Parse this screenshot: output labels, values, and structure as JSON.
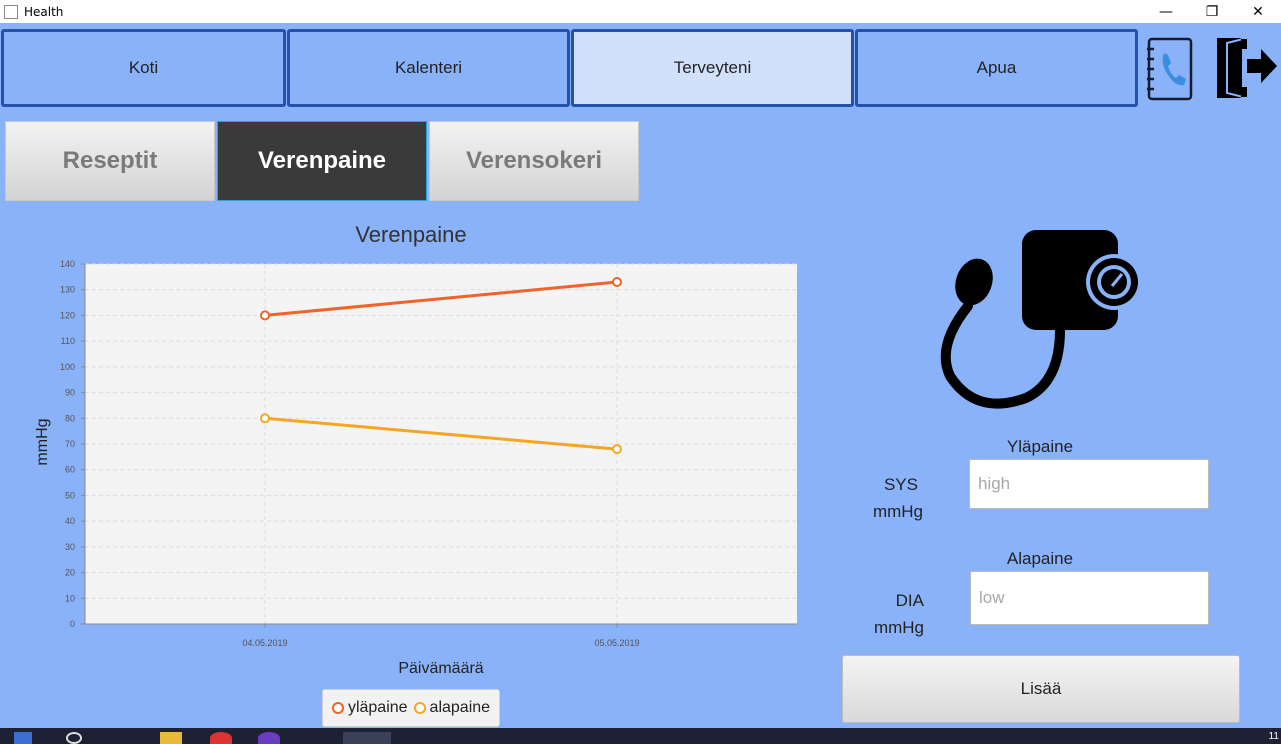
{
  "window": {
    "title": "Health"
  },
  "nav": {
    "tabs": [
      {
        "label": "Koti"
      },
      {
        "label": "Kalenteri"
      },
      {
        "label": "Terveyteni"
      },
      {
        "label": "Apua"
      }
    ],
    "active_index": 2
  },
  "subtabs": {
    "items": [
      {
        "label": "Reseptit"
      },
      {
        "label": "Verenpaine"
      },
      {
        "label": "Verensokeri"
      }
    ],
    "active_index": 1
  },
  "chart_data": {
    "type": "line",
    "title": "Verenpaine",
    "xlabel": "Päivämäärä",
    "ylabel": "mmHg",
    "categories": [
      "04.05.2019",
      "05.05.2019"
    ],
    "series": [
      {
        "name": "yläpaine",
        "values": [
          120,
          133
        ],
        "color": "#f0632a"
      },
      {
        "name": "alapaine",
        "values": [
          80,
          68
        ],
        "color": "#f5a623"
      }
    ],
    "ylim": [
      0,
      140
    ],
    "yticks": [
      0,
      10,
      20,
      30,
      40,
      50,
      60,
      70,
      80,
      90,
      100,
      110,
      120,
      130,
      140
    ],
    "grid": true,
    "legend": "bottom"
  },
  "form": {
    "high_title": "Yläpaine",
    "high_unit_line1": "SYS",
    "high_unit_line2": "mmHg",
    "high_placeholder": "high",
    "low_title": "Alapaine",
    "low_unit_line1": "DIA",
    "low_unit_line2": "mmHg",
    "low_placeholder": "low",
    "submit_label": "Lisää"
  },
  "taskbar": {
    "clock": "11"
  },
  "colors": {
    "background": "#8ab2f8",
    "nav_border": "#2551a8",
    "nav_active": "#d2e1fb",
    "subtab_active": "#3a3a3a"
  }
}
